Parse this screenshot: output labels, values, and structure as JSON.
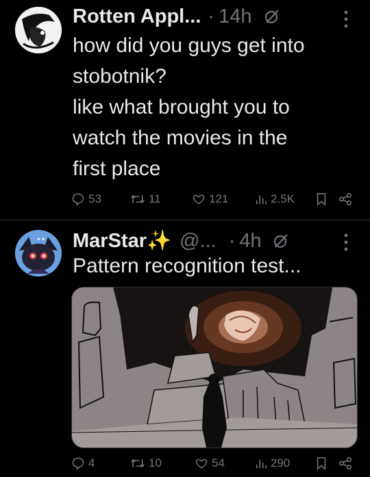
{
  "tweets": [
    {
      "author": "Rotten Appl...",
      "separator": "·",
      "time": "14h",
      "text": "how did you guys get into\nstobotnik?\nlike what brought you to\nwatch the movies in the\nfirst place",
      "stats": {
        "replies": "53",
        "reposts": "11",
        "likes": "121",
        "views": "2.5K"
      }
    },
    {
      "author": "MarStar✨",
      "handle": "@...",
      "separator": "·",
      "time": "4h",
      "text": "Pattern recognition test...",
      "stats": {
        "replies": "4",
        "reposts": "10",
        "likes": "54",
        "views": "290"
      }
    }
  ],
  "colors": {
    "background": "#000000",
    "text": "#e7e9ea",
    "muted": "#71767b",
    "divider": "#2f3336"
  },
  "icons": [
    "reply-icon",
    "repost-icon",
    "like-icon",
    "views-icon",
    "bookmark-icon",
    "share-icon",
    "grok-icon",
    "more-icon"
  ]
}
